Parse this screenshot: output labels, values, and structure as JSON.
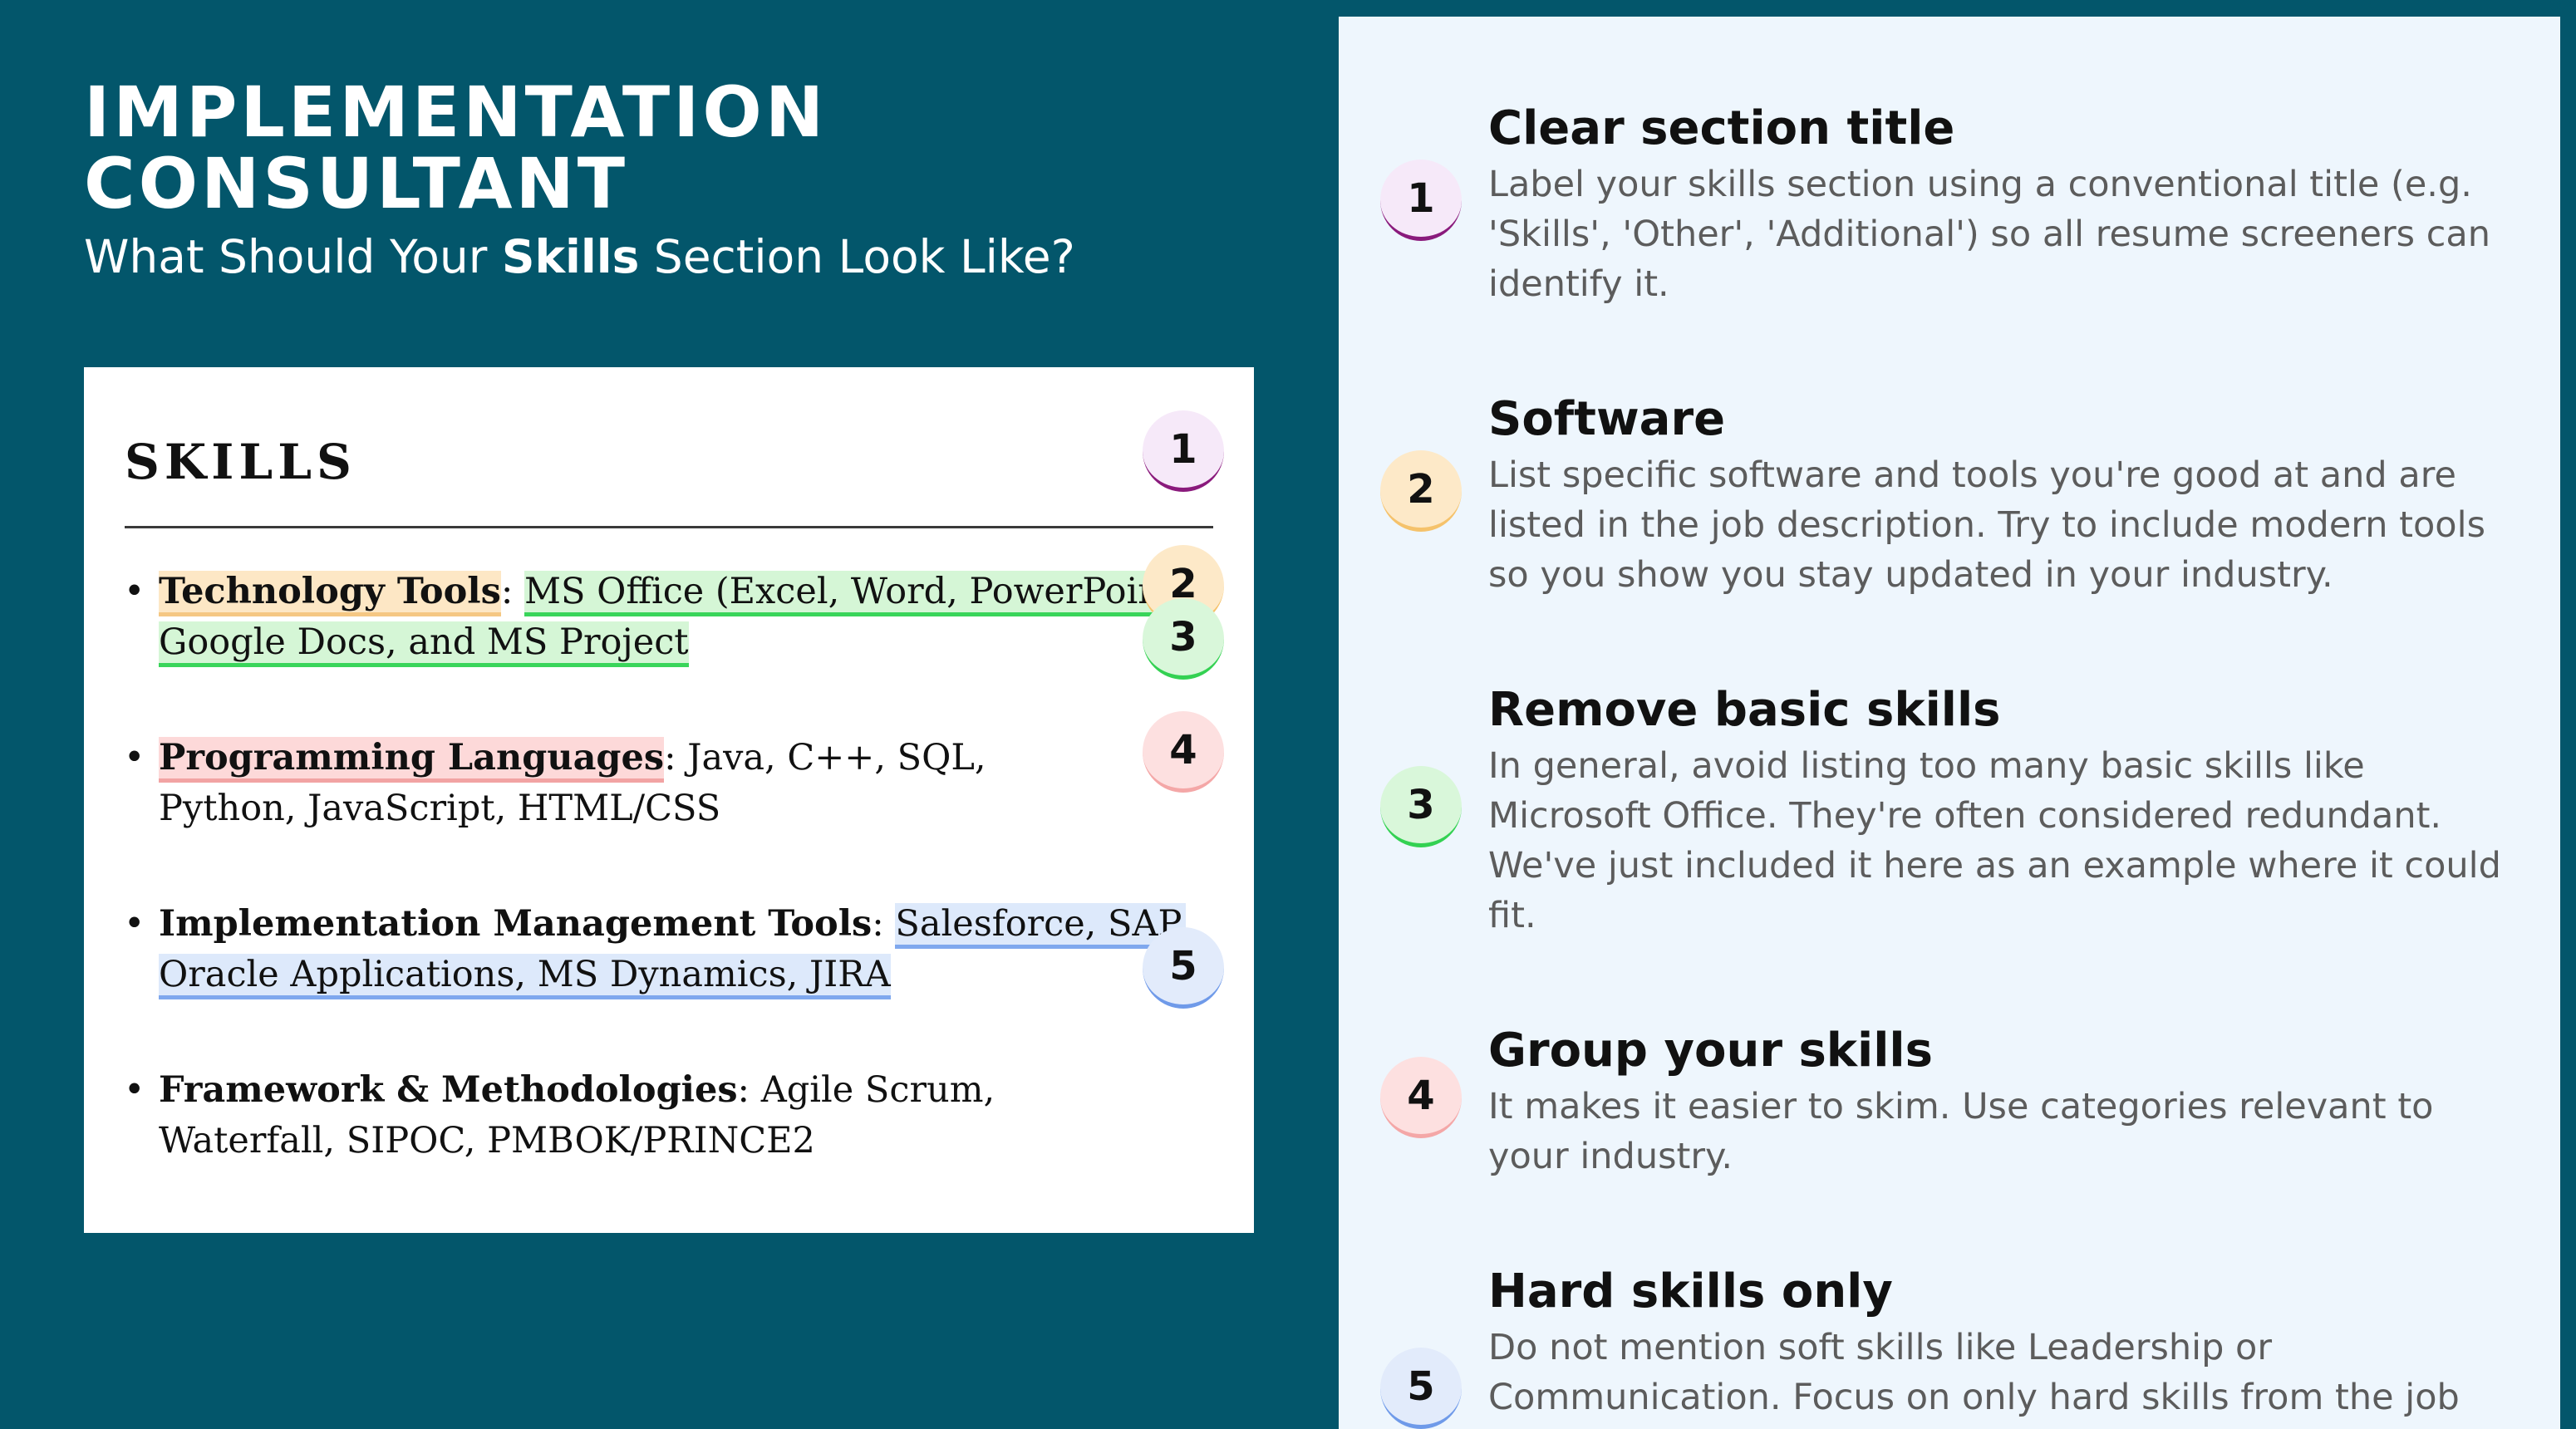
{
  "header": {
    "title_line1": "IMPLEMENTATION",
    "title_line2": "CONSULTANT",
    "subtitle_pre": "What Should Your ",
    "subtitle_bold": "Skills",
    "subtitle_post": " Section Look Like?"
  },
  "resume": {
    "heading": "SKILLS",
    "bullet": "•",
    "items": [
      {
        "label": "Technology Tools",
        "sep": ": ",
        "value_line1": "MS Office (Excel, Word, PowerPoint),",
        "value_line2": "Google Docs, and MS Project"
      },
      {
        "label": "Programming Languages",
        "sep": ": ",
        "value": "Java, C++, SQL, Python, JavaScript, HTML/CSS"
      },
      {
        "label": "Implementation Management Tools",
        "sep": ": ",
        "value_line1": "Salesforce, SAP,",
        "value_line2": "Oracle Applications, MS Dynamics, JIRA"
      },
      {
        "label": "Framework & Methodologies",
        "sep": ": ",
        "value": "Agile Scrum, Waterfall, SIPOC, PMBOK/PRINCE2"
      }
    ],
    "markers": [
      "1",
      "2",
      "3",
      "4",
      "5"
    ]
  },
  "tips": [
    {
      "num": "1",
      "title": "Clear section title",
      "desc": "Label your skills section using a conventional title (e.g. 'Skills', 'Other', 'Additional') so all resume screeners can identify it."
    },
    {
      "num": "2",
      "title": "Software",
      "desc": "List specific software and tools you're good at and are listed in the job description. Try to include modern tools so you show you stay updated in your industry."
    },
    {
      "num": "3",
      "title": "Remove basic skills",
      "desc": "In general, avoid listing too many basic skills like Microsoft Office. They're often considered redundant. We've just included it here as an example where it could fit."
    },
    {
      "num": "4",
      "title": "Group your skills",
      "desc": "It makes it easier to skim. Use categories relevant to your industry."
    },
    {
      "num": "5",
      "title": "Hard skills only",
      "desc": "Do not mention soft skills like Leadership or Communication. Focus on only hard skills from the job"
    }
  ]
}
